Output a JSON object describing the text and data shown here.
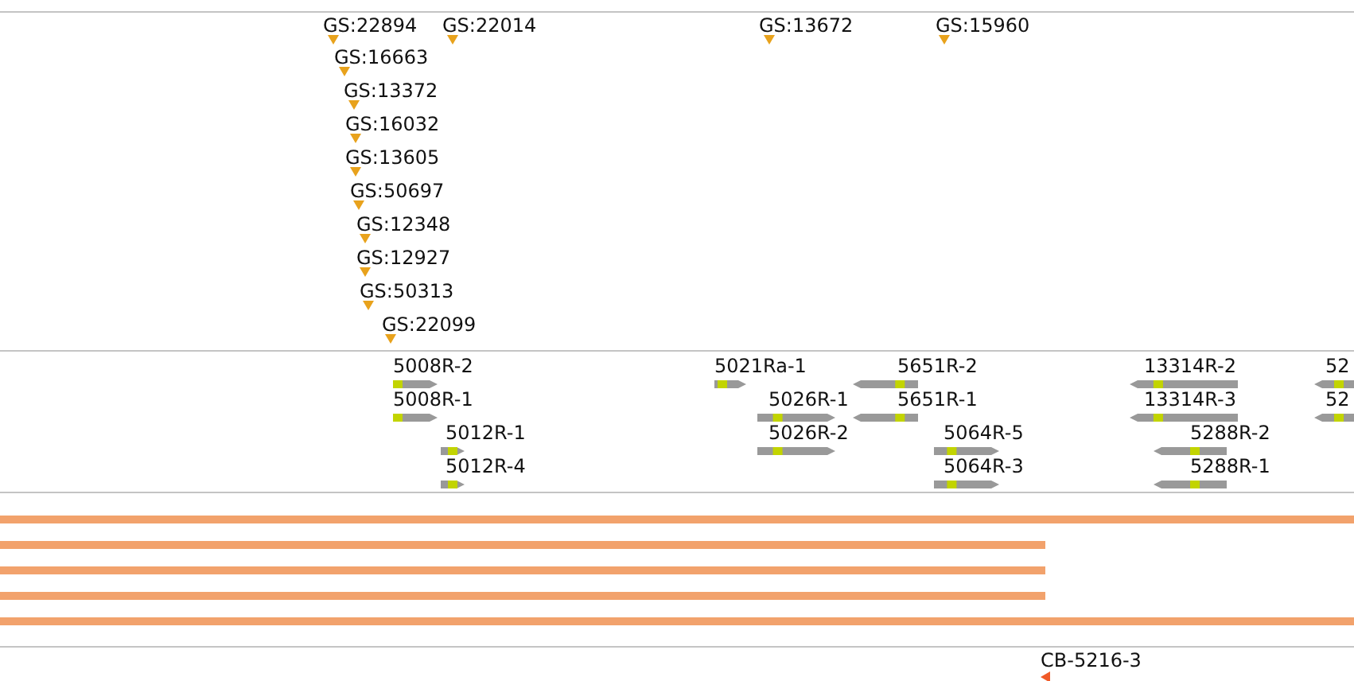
{
  "markers": [
    {
      "label": "GS:22894"
    },
    {
      "label": "GS:22014"
    },
    {
      "label": "GS:13672"
    },
    {
      "label": "GS:15960"
    },
    {
      "label": "GS:16663"
    },
    {
      "label": "GS:13372"
    },
    {
      "label": "GS:16032"
    },
    {
      "label": "GS:13605"
    },
    {
      "label": "GS:50697"
    },
    {
      "label": "GS:12348"
    },
    {
      "label": "GS:12927"
    },
    {
      "label": "GS:50313"
    },
    {
      "label": "GS:22099"
    }
  ],
  "transcripts": [
    {
      "label": "5008R-2",
      "kind": "forward"
    },
    {
      "label": "5008R-1",
      "kind": "forward"
    },
    {
      "label": "5012R-1",
      "kind": "forward"
    },
    {
      "label": "5012R-4",
      "kind": "forward"
    },
    {
      "label": "5021Ra-1",
      "kind": "forward"
    },
    {
      "label": "5026R-1",
      "kind": "forward"
    },
    {
      "label": "5026R-2",
      "kind": "forward"
    },
    {
      "label": "5651R-2",
      "kind": "reverse"
    },
    {
      "label": "5651R-1",
      "kind": "reverse"
    },
    {
      "label": "5064R-5",
      "kind": "forward"
    },
    {
      "label": "5064R-3",
      "kind": "forward"
    },
    {
      "label": "13314R-2",
      "kind": "reverse"
    },
    {
      "label": "13314R-3",
      "kind": "reverse"
    },
    {
      "label": "5288R-2",
      "kind": "reverse"
    },
    {
      "label": "5288R-1",
      "kind": "reverse"
    },
    {
      "label": "52",
      "kind": "reverse"
    },
    {
      "label": "52",
      "kind": "reverse"
    }
  ],
  "coverage_bars": [
    {
      "kind": "full"
    },
    {
      "kind": "partial"
    },
    {
      "kind": "partial"
    },
    {
      "kind": "partial"
    },
    {
      "kind": "full"
    }
  ],
  "features": [
    {
      "label": "CB-5216-3",
      "kind": "reverse"
    }
  ]
}
